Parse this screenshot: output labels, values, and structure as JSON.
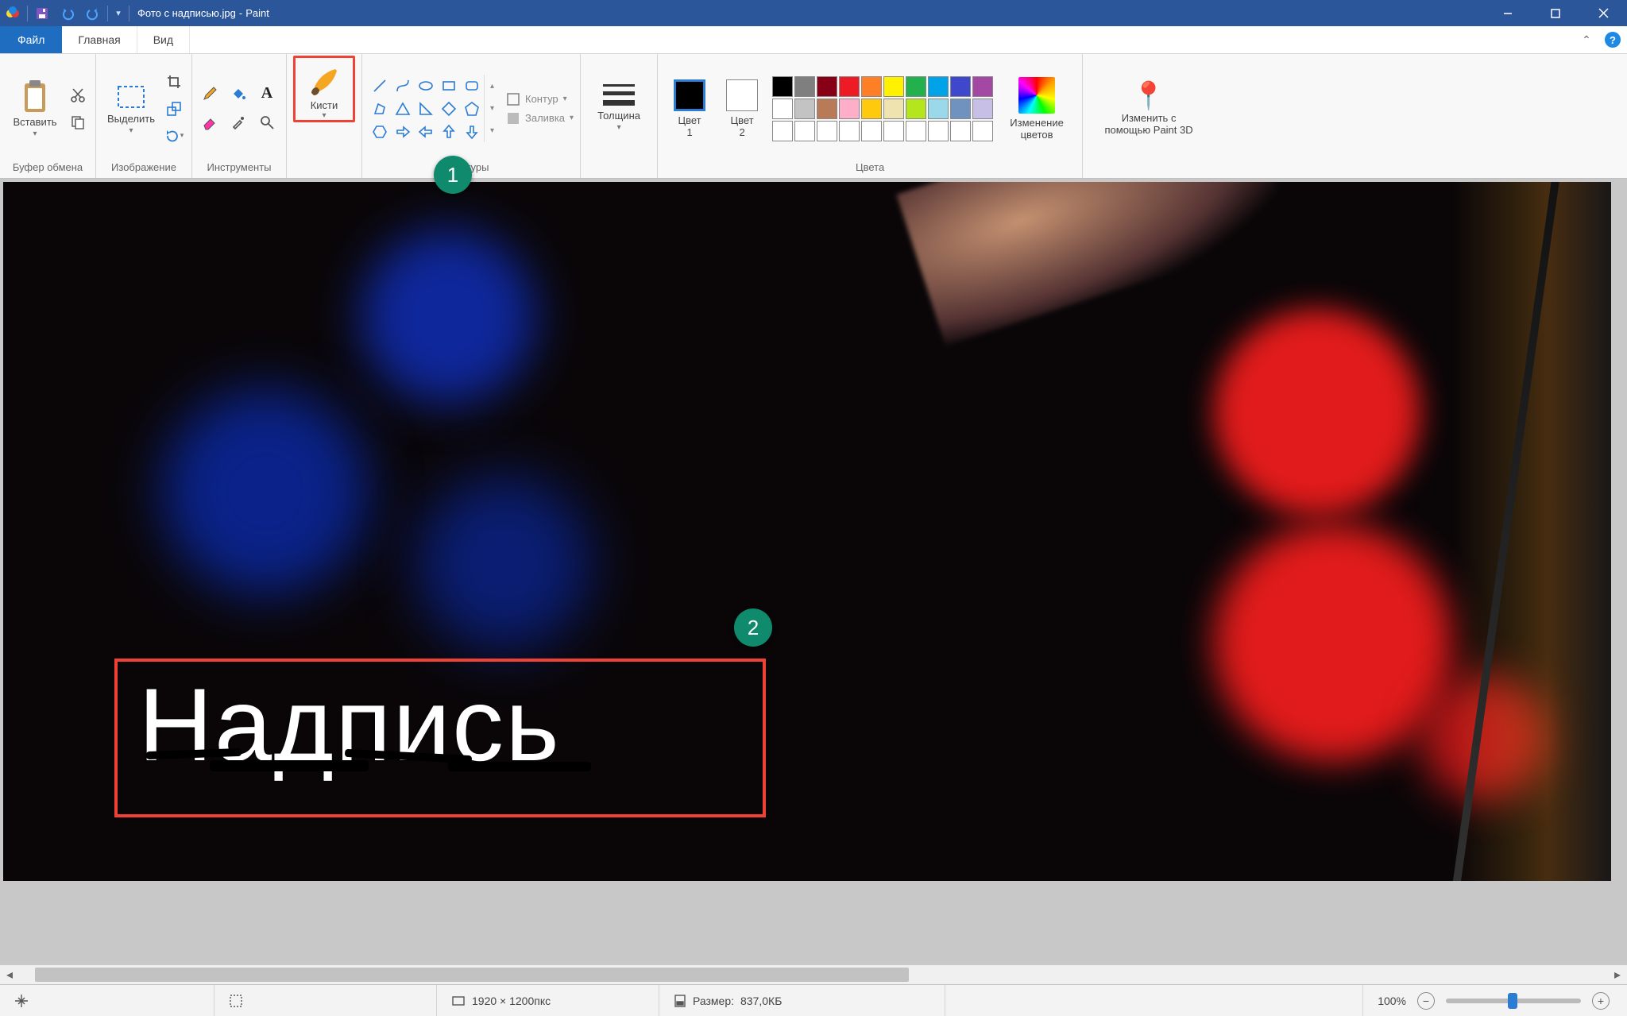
{
  "titlebar": {
    "document": "Фото с надписью.jpg",
    "app": "Paint"
  },
  "tabs": {
    "file": "Файл",
    "home": "Главная",
    "view": "Вид"
  },
  "ribbon": {
    "clipboard": {
      "paste": "Вставить",
      "label": "Буфер обмена"
    },
    "image": {
      "select": "Выделить",
      "label": "Изображение"
    },
    "tools": {
      "label": "Инструменты"
    },
    "brushes": {
      "btn": "Кисти"
    },
    "shapes": {
      "outline": "Контур",
      "fill": "Заливка",
      "label": "Фигуры"
    },
    "thickness": {
      "label": "Толщина"
    },
    "color1": {
      "line1": "Цвет",
      "line2": "1"
    },
    "color2": {
      "line1": "Цвет",
      "line2": "2"
    },
    "colors_label": "Цвета",
    "edit_colors": {
      "line1": "Изменение",
      "line2": "цветов"
    },
    "paint3d": {
      "line1": "Изменить с",
      "line2": "помощью Paint 3D"
    }
  },
  "palette": {
    "row1": [
      "#000000",
      "#7f7f7f",
      "#880015",
      "#ed1c24",
      "#ff7f27",
      "#fff200",
      "#22b14c",
      "#00a2e8",
      "#3f48cc",
      "#a349a4"
    ],
    "row2": [
      "#ffffff",
      "#c3c3c3",
      "#b97a57",
      "#ffaec9",
      "#ffc90e",
      "#efe4b0",
      "#b5e61d",
      "#99d9ea",
      "#7092be",
      "#c8bfe7"
    ],
    "row3": [
      "#ffffff",
      "#ffffff",
      "#ffffff",
      "#ffffff",
      "#ffffff",
      "#ffffff",
      "#ffffff",
      "#ffffff",
      "#ffffff",
      "#ffffff"
    ]
  },
  "canvas": {
    "text": "Надпись"
  },
  "markers": {
    "m1": "1",
    "m2": "2"
  },
  "statusbar": {
    "dimensions": "1920 × 1200пкс",
    "size_label": "Размер:",
    "size_value": "837,0КБ",
    "zoom": "100%"
  }
}
